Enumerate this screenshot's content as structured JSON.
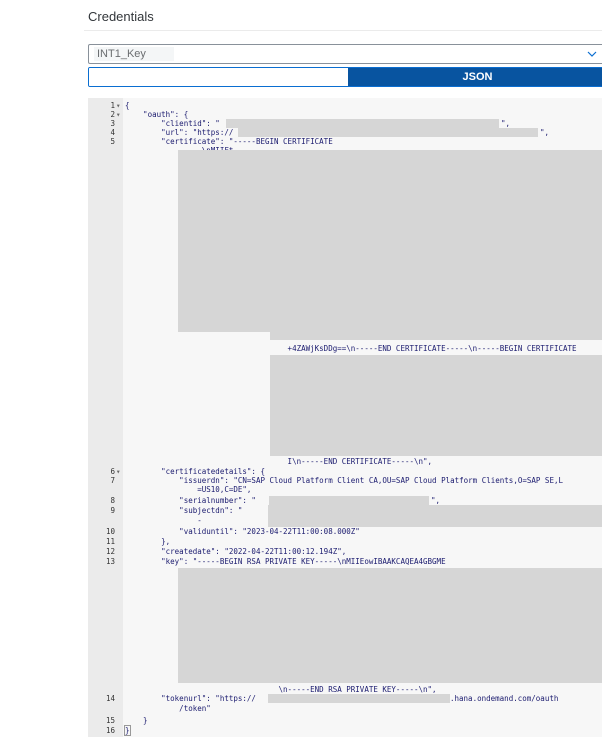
{
  "header": {
    "title": "Credentials"
  },
  "key_select": {
    "value": "INT1_Key"
  },
  "view_toggle": {
    "left_label": "",
    "json_label": "JSON"
  },
  "editor": {
    "line_numbers": [
      "1",
      "2",
      "3",
      "4",
      "5",
      "6",
      "7",
      "8",
      "9",
      "10",
      "11",
      "12",
      "13",
      "14",
      "15",
      "16"
    ],
    "l1": "{",
    "l2": "    \"oauth\": {",
    "l3": "        \"clientid\": \"",
    "l3_end": "\",",
    "l4": "        \"url\": \"https://",
    "l4_end": "\",",
    "l5": "        \"certificate\": \"-----BEGIN CERTIFICATE",
    "l5b": "            -----\\nMIIFt",
    "cert_mid1": "                                    +4ZAWjKsDDg==\\n-----END CERTIFICATE-----\\n-----BEGIN CERTIFICATE",
    "cert_end": "                                    I\\n-----END CERTIFICATE-----\\n\",",
    "l6": "        \"certificatedetails\": {",
    "l7": "            \"issuerdn\": \"CN=SAP Cloud Platform Client CA,OU=SAP Cloud Platform Clients,O=SAP SE,L",
    "l7b": "                =US10,C=DE\",",
    "l8": "            \"serialnumber\": \"",
    "l8_end": "\",",
    "l9": "            \"subjectdn\": \"",
    "l9b": "                -",
    "l10": "            \"validuntil\": \"2023-04-22T11:00:08.000Z\"",
    "l11": "        },",
    "l12": "        \"createdate\": \"2022-04-22T11:00:12.194Z\",",
    "l13": "        \"key\": \"-----BEGIN RSA PRIVATE KEY-----\\nMIIEowIBAAKCAQEA4GBGME",
    "key_end": "                                  \\n-----END RSA PRIVATE KEY-----\\n\",",
    "l14": "        \"tokenurl\": \"https://",
    "l14_end": ".hana.ondemand.com/oauth",
    "l14b": "            /token\"",
    "l15": "    }",
    "l16": "}"
  }
}
